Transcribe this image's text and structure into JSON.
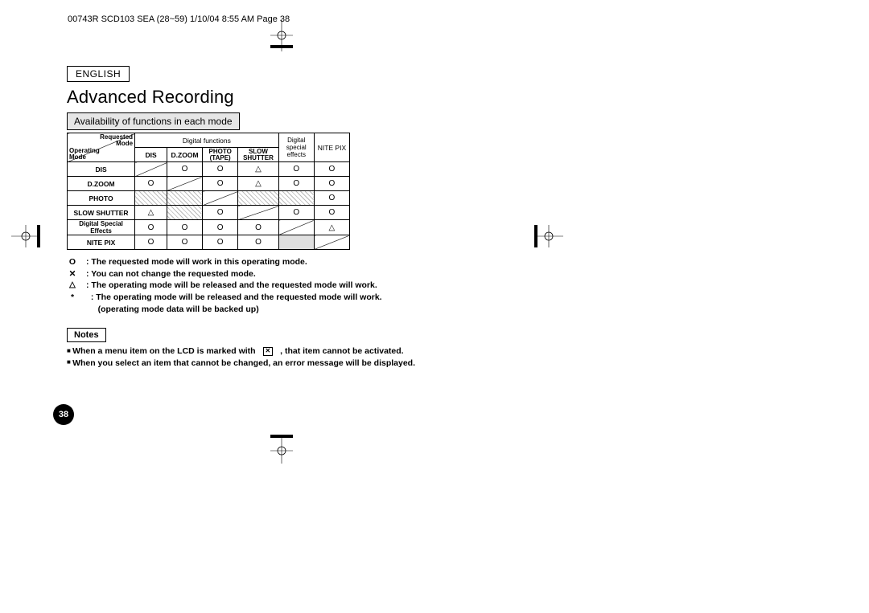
{
  "header_text": "00743R SCD103 SEA (28~59)  1/10/04 8:55 AM  Page 38",
  "language": "ENGLISH",
  "title": "Advanced Recording",
  "subtitle": "Availability of functions in each mode",
  "page_number": "38",
  "table": {
    "corner": {
      "requested": "Requested\nMode",
      "operating": "Operating\nMode"
    },
    "col_groups": {
      "digital": "Digital functions",
      "special": "Digital\nspecial\neffects",
      "nite": "NITE PIX"
    },
    "cols": {
      "dis": "DIS",
      "dzoom": "D.ZOOM",
      "photo": "PHOTO\n(TAPE)",
      "slow": "SLOW\nSHUTTER"
    },
    "row_labels": {
      "dis": "DIS",
      "dzoom": "D.ZOOM",
      "photo": "PHOTO",
      "slow": "SLOW SHUTTER",
      "dse": "Digital Special Effects",
      "nite": "NITE PIX"
    },
    "cells": {
      "dis": {
        "dis": "",
        "dzoom": "O",
        "photo": "O",
        "slow": "△",
        "dse": "O",
        "nite": "O"
      },
      "dzoom": {
        "dis": "O",
        "dzoom": "",
        "photo": "O",
        "slow": "△",
        "dse": "O",
        "nite": "O"
      },
      "photo": {
        "dis": "",
        "dzoom": "",
        "photo": "",
        "slow": "",
        "dse": "",
        "nite": "O"
      },
      "slow": {
        "dis": "△",
        "dzoom": "",
        "photo": "O",
        "slow": "",
        "dse": "O",
        "nite": "O"
      },
      "dse": {
        "dis": "O",
        "dzoom": "O",
        "photo": "O",
        "slow": "O",
        "dse": "",
        "nite": "△"
      },
      "nite": {
        "dis": "O",
        "dzoom": "O",
        "photo": "O",
        "slow": "O",
        "dse": "",
        "nite": ""
      }
    }
  },
  "legend": {
    "o_sym": "O",
    "o_text": "  : The requested mode will work in this operating mode.",
    "x_text": "  : You can not change the requested mode.",
    "tri_text": "  : The operating mode will be released and the requested mode will work.",
    "star_text": "  : The operating mode will be released and the requested mode will work.\n     (operating mode data will be backed up)"
  },
  "notes": {
    "title": "Notes",
    "n1_a": "When a menu item on the LCD is marked with ",
    "n1_b": ", that item cannot be activated.",
    "n2": "When you select an item that cannot be changed, an error message will be displayed."
  },
  "chart_data": {
    "type": "table",
    "title": "Availability of functions in each mode",
    "xlabel": "Requested Mode",
    "ylabel": "Operating Mode",
    "categories": [
      "DIS",
      "D.ZOOM",
      "PHOTO (TAPE)",
      "SLOW SHUTTER",
      "Digital special effects",
      "NITE PIX"
    ],
    "series": [
      {
        "name": "DIS",
        "values": [
          "diag",
          "O",
          "O",
          "△",
          "O",
          "O"
        ]
      },
      {
        "name": "D.ZOOM",
        "values": [
          "O",
          "diag",
          "O",
          "△",
          "O",
          "O"
        ]
      },
      {
        "name": "PHOTO",
        "values": [
          "hatch",
          "hatch",
          "diag",
          "hatch",
          "hatch",
          "O"
        ]
      },
      {
        "name": "SLOW SHUTTER",
        "values": [
          "△",
          "hatch",
          "O",
          "diag",
          "O",
          "O"
        ]
      },
      {
        "name": "Digital Special Effects",
        "values": [
          "O",
          "O",
          "O",
          "O",
          "diag",
          "△"
        ]
      },
      {
        "name": "NITE PIX",
        "values": [
          "O",
          "O",
          "O",
          "O",
          "grey",
          "diag"
        ]
      }
    ],
    "annotations": [
      "O = requested mode will work in this operating mode",
      "blank = you can not change the requested mode",
      "△ = operating mode will be released and requested mode will work",
      "* = operating mode released, requested works, data backed up"
    ]
  }
}
